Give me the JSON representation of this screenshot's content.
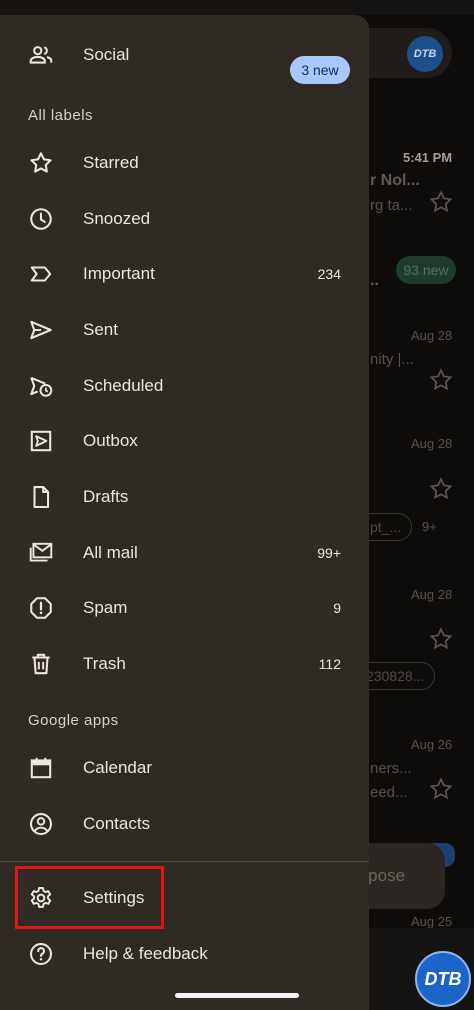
{
  "drawer": {
    "social": {
      "label": "Social",
      "badge": "3 new"
    },
    "all_labels_header": "All labels",
    "labels": [
      {
        "label": "Starred",
        "count": ""
      },
      {
        "label": "Snoozed",
        "count": ""
      },
      {
        "label": "Important",
        "count": "234"
      },
      {
        "label": "Sent",
        "count": ""
      },
      {
        "label": "Scheduled",
        "count": ""
      },
      {
        "label": "Outbox",
        "count": ""
      },
      {
        "label": "Drafts",
        "count": ""
      },
      {
        "label": "All mail",
        "count": "99+"
      },
      {
        "label": "Spam",
        "count": "9"
      },
      {
        "label": "Trash",
        "count": "112"
      }
    ],
    "google_apps_header": "Google apps",
    "apps": [
      {
        "label": "Calendar"
      },
      {
        "label": "Contacts"
      }
    ],
    "settings_label": "Settings",
    "help_label": "Help & feedback"
  },
  "background": {
    "avatar_text": "DTB",
    "rows": [
      {
        "time": "5:41 PM",
        "line1": "r Nol...",
        "line2": "rg ta..."
      },
      {
        "line1": "..",
        "badge": "93 new"
      },
      {
        "time": "Aug 28",
        "line2": "nity |..."
      },
      {
        "time": "Aug 28",
        "chip": "pt_...",
        "chip_more": "9+"
      },
      {
        "time": "Aug 28",
        "chip": "230828..."
      },
      {
        "time": "Aug 26",
        "line1": "ners...",
        "line2": "eed..."
      },
      {
        "time": "Aug 25"
      }
    ],
    "compose_label": "mpose"
  },
  "watermark_text": "DTB",
  "colors": {
    "drawer_bg": "#2f2a24",
    "badge_bg": "#a9c7fa",
    "highlight": "#e3121b"
  }
}
